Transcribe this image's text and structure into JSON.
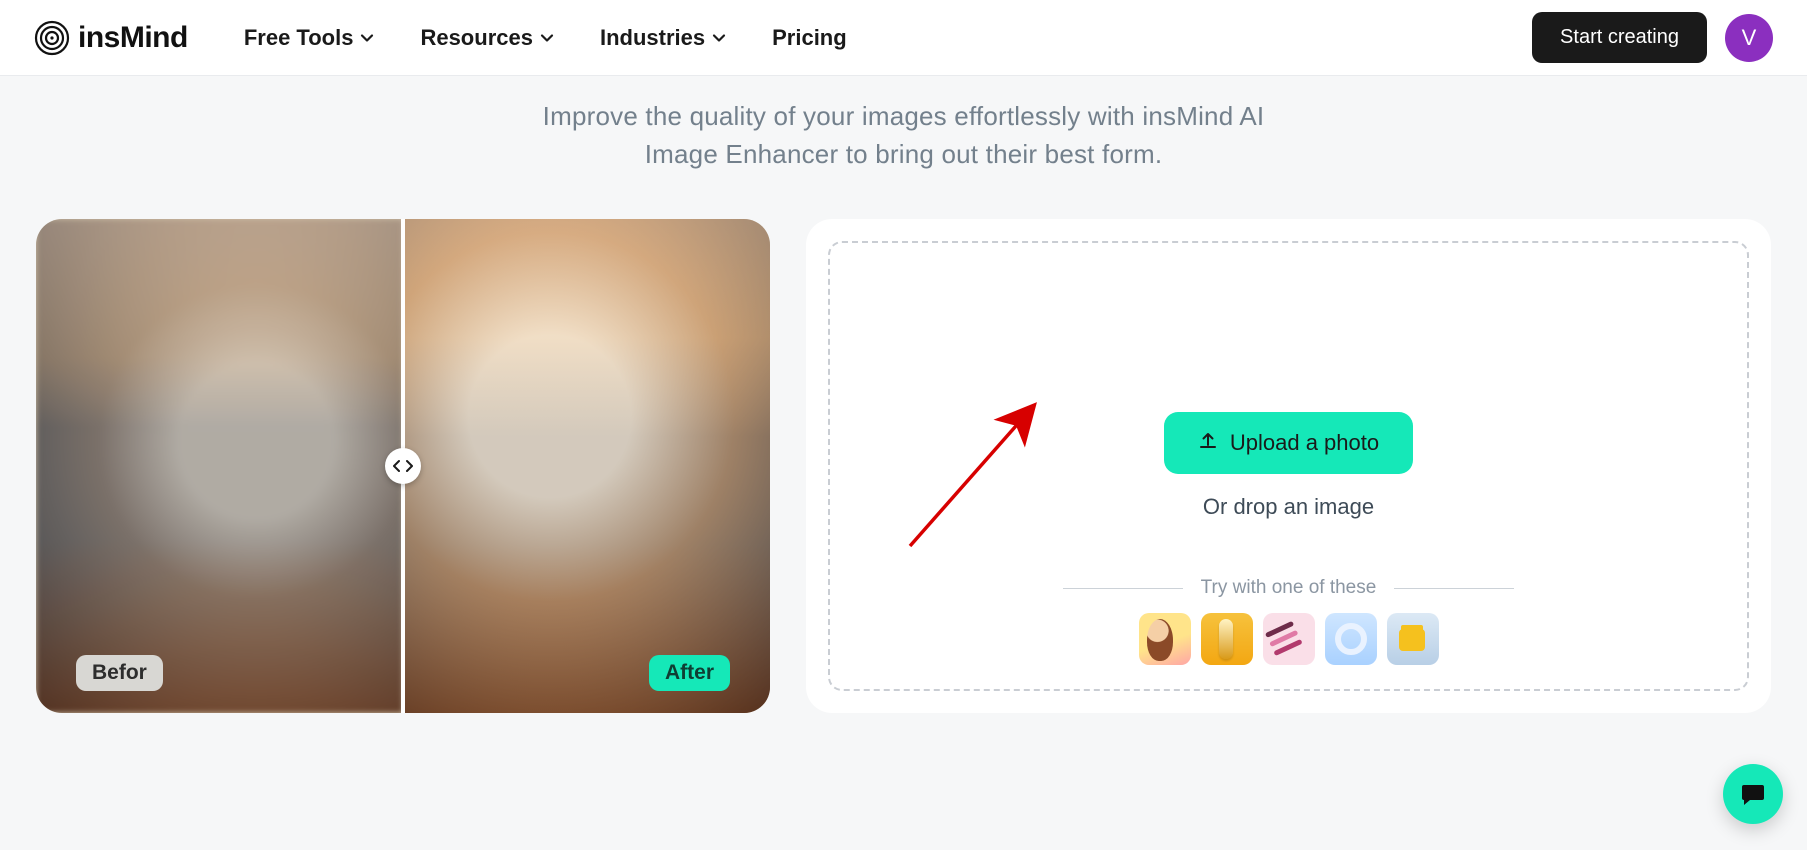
{
  "brand": {
    "name": "insMind"
  },
  "nav": {
    "items": [
      {
        "label": "Free Tools",
        "hasDropdown": true
      },
      {
        "label": "Resources",
        "hasDropdown": true
      },
      {
        "label": "Industries",
        "hasDropdown": true
      },
      {
        "label": "Pricing",
        "hasDropdown": false
      }
    ],
    "cta": "Start creating",
    "avatar_initial": "V"
  },
  "hero": {
    "tagline_line1": "Improve the quality of your images effortlessly with insMind AI",
    "tagline_line2": "Image Enhancer to bring out their best form."
  },
  "compare": {
    "before_label": "Befor",
    "after_label": "After"
  },
  "upload": {
    "button_label": "Upload a photo",
    "drop_hint": "Or drop an image",
    "samples_title": "Try with one of these",
    "samples": [
      {
        "name": "sample-person"
      },
      {
        "name": "sample-serum"
      },
      {
        "name": "sample-brushes"
      },
      {
        "name": "sample-headphones"
      },
      {
        "name": "sample-handbag"
      }
    ]
  },
  "colors": {
    "accent": "#15e8b8",
    "ink": "#1a1a1a",
    "muted": "#73808c"
  }
}
